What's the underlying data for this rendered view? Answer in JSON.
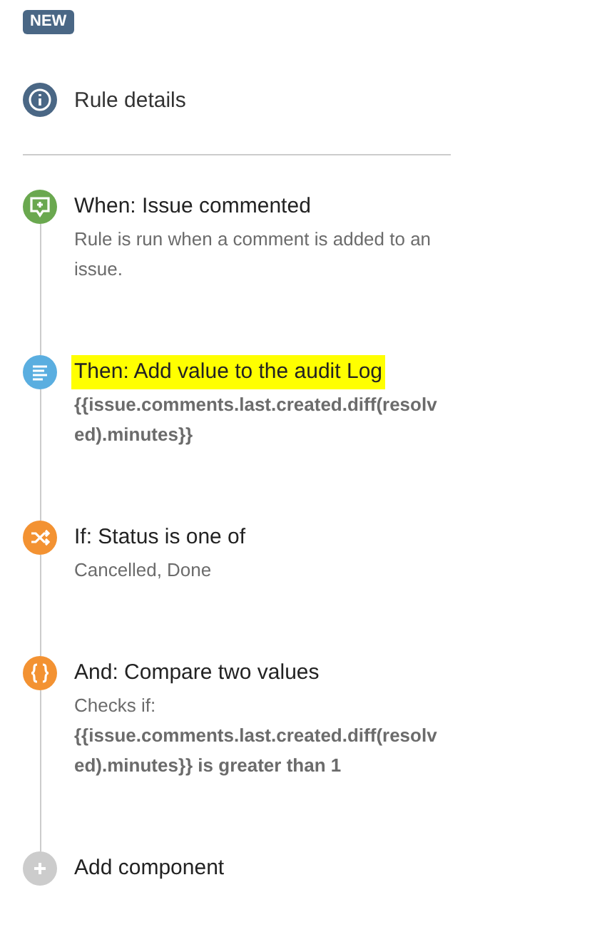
{
  "badge": "NEW",
  "rule_details": {
    "label": "Rule details"
  },
  "steps": [
    {
      "kind": "trigger",
      "title": "When: Issue commented",
      "highlighted": false,
      "details": [
        {
          "kind": "text",
          "text": "Rule is run when a comment is added to an issue."
        }
      ]
    },
    {
      "kind": "action",
      "title": "Then: Add value to the audit Log",
      "highlighted": true,
      "details": [
        {
          "kind": "code",
          "text": "{{issue.comments.last.created.diff(resolved).minutes}}"
        }
      ]
    },
    {
      "kind": "condition",
      "title": "If: Status is one of",
      "highlighted": false,
      "details": [
        {
          "kind": "text",
          "text": "Cancelled, Done"
        }
      ]
    },
    {
      "kind": "compare",
      "title": "And: Compare two values",
      "highlighted": false,
      "details": [
        {
          "kind": "text",
          "text": "Checks if:"
        },
        {
          "kind": "code",
          "text": "{{issue.comments.last.created.diff(resolved).minutes}} is greater than 1"
        }
      ]
    }
  ],
  "add_component": {
    "label": "Add component"
  }
}
